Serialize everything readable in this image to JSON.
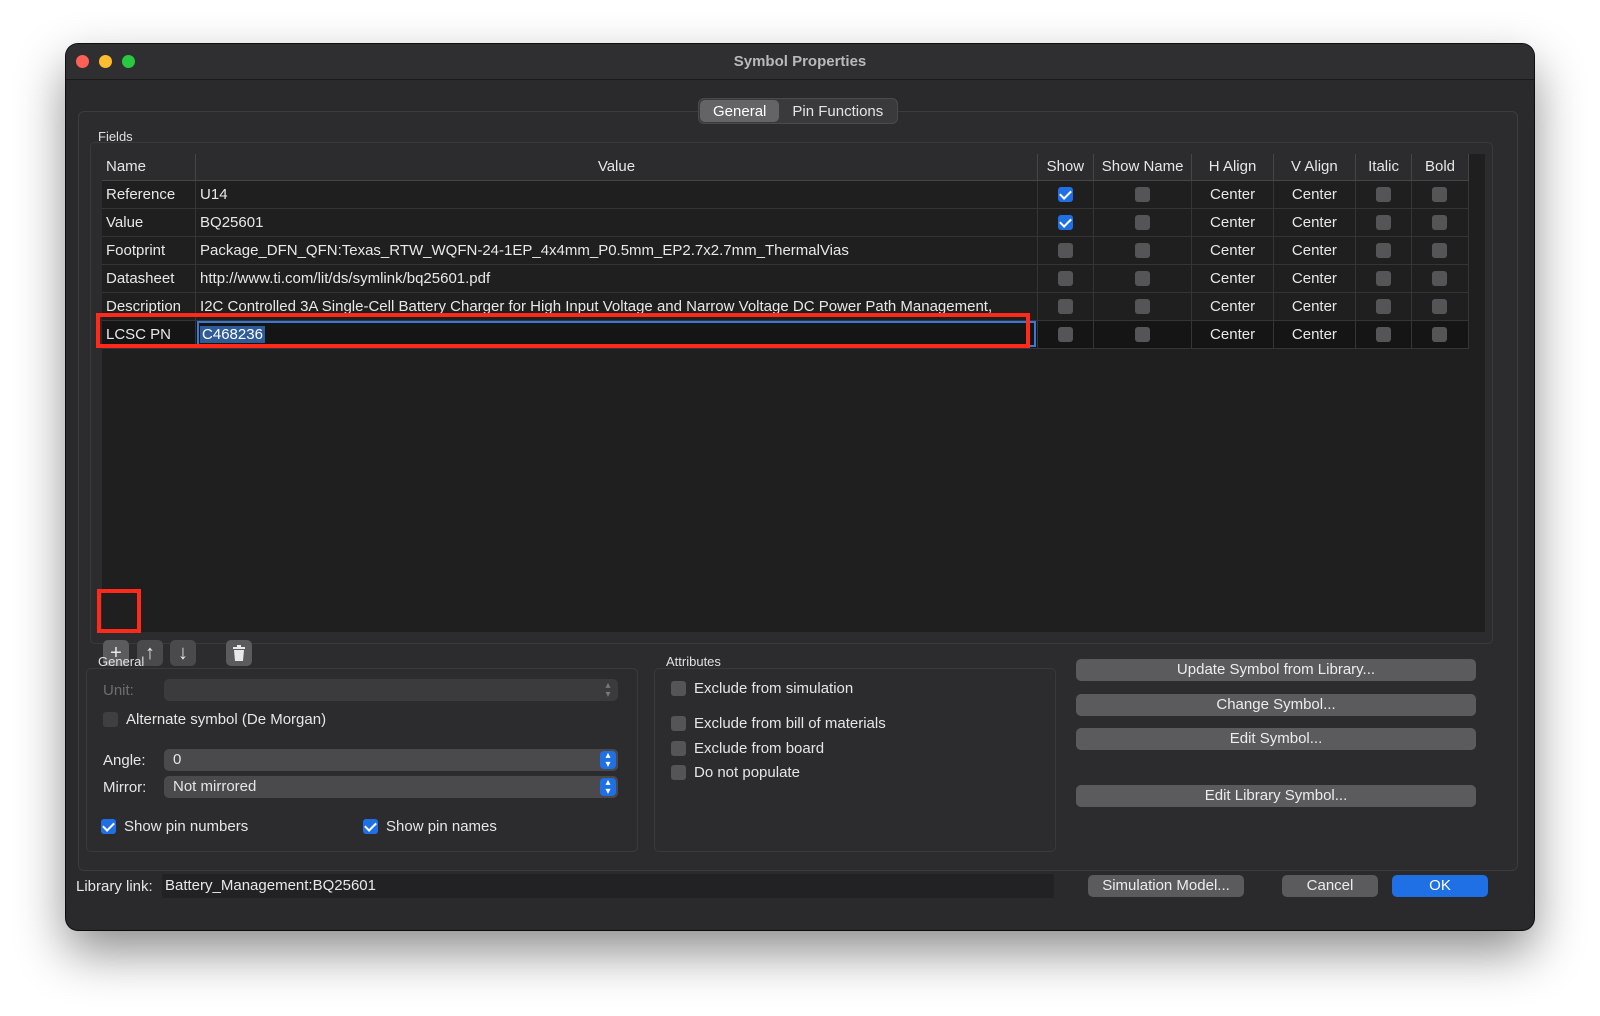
{
  "window": {
    "title": "Symbol Properties"
  },
  "tabs": [
    {
      "label": "General",
      "active": true
    },
    {
      "label": "Pin Functions",
      "active": false
    }
  ],
  "fields": {
    "group_label": "Fields",
    "columns": [
      "Name",
      "Value",
      "Show",
      "Show Name",
      "H Align",
      "V Align",
      "Italic",
      "Bold"
    ],
    "rows": [
      {
        "name": "Reference",
        "value": "U14",
        "show": true,
        "show_name": false,
        "h_align": "Center",
        "v_align": "Center",
        "italic": false,
        "bold": false
      },
      {
        "name": "Value",
        "value": "BQ25601",
        "show": true,
        "show_name": false,
        "h_align": "Center",
        "v_align": "Center",
        "italic": false,
        "bold": false
      },
      {
        "name": "Footprint",
        "value": "Package_DFN_QFN:Texas_RTW_WQFN-24-1EP_4x4mm_P0.5mm_EP2.7x2.7mm_ThermalVias",
        "show": false,
        "show_name": false,
        "h_align": "Center",
        "v_align": "Center",
        "italic": false,
        "bold": false
      },
      {
        "name": "Datasheet",
        "value": "http://www.ti.com/lit/ds/symlink/bq25601.pdf",
        "show": false,
        "show_name": false,
        "h_align": "Center",
        "v_align": "Center",
        "italic": false,
        "bold": false
      },
      {
        "name": "Description",
        "value": "I2C Controlled 3A Single-Cell Battery Charger for High Input Voltage and Narrow Voltage DC Power Path Management,",
        "show": false,
        "show_name": false,
        "h_align": "Center",
        "v_align": "Center",
        "italic": false,
        "bold": false
      },
      {
        "name": "LCSC PN",
        "value": "C468236",
        "show": false,
        "show_name": false,
        "h_align": "Center",
        "v_align": "Center",
        "italic": false,
        "bold": false
      }
    ],
    "toolbar": {
      "add_icon": "plus-icon",
      "up_icon": "arrow-up-icon",
      "down_icon": "arrow-down-icon",
      "delete_icon": "trash-icon"
    }
  },
  "general": {
    "group_label": "General",
    "unit_label": "Unit:",
    "unit_value": "",
    "alternate_label": "Alternate symbol (De Morgan)",
    "alternate_checked": false,
    "angle_label": "Angle:",
    "angle_value": "0",
    "mirror_label": "Mirror:",
    "mirror_value": "Not mirrored",
    "show_pin_numbers_label": "Show pin numbers",
    "show_pin_numbers": true,
    "show_pin_names_label": "Show pin names",
    "show_pin_names": true
  },
  "attributes": {
    "group_label": "Attributes",
    "items": [
      {
        "label": "Exclude from simulation",
        "checked": false
      },
      {
        "label": "Exclude from bill of materials",
        "checked": false
      },
      {
        "label": "Exclude from board",
        "checked": false
      },
      {
        "label": "Do not populate",
        "checked": false
      }
    ]
  },
  "actions": {
    "update_symbol": "Update Symbol from Library...",
    "change_symbol": "Change Symbol...",
    "edit_symbol": "Edit Symbol...",
    "edit_library_symbol": "Edit Library Symbol..."
  },
  "footer": {
    "library_link_label": "Library link:",
    "library_link_value": "Battery_Management:BQ25601",
    "simulation_model": "Simulation Model...",
    "cancel": "Cancel",
    "ok": "OK"
  },
  "colors": {
    "accent": "#1f6fe5",
    "highlight": "#ff2a1a",
    "background": "#2a2a2c"
  }
}
